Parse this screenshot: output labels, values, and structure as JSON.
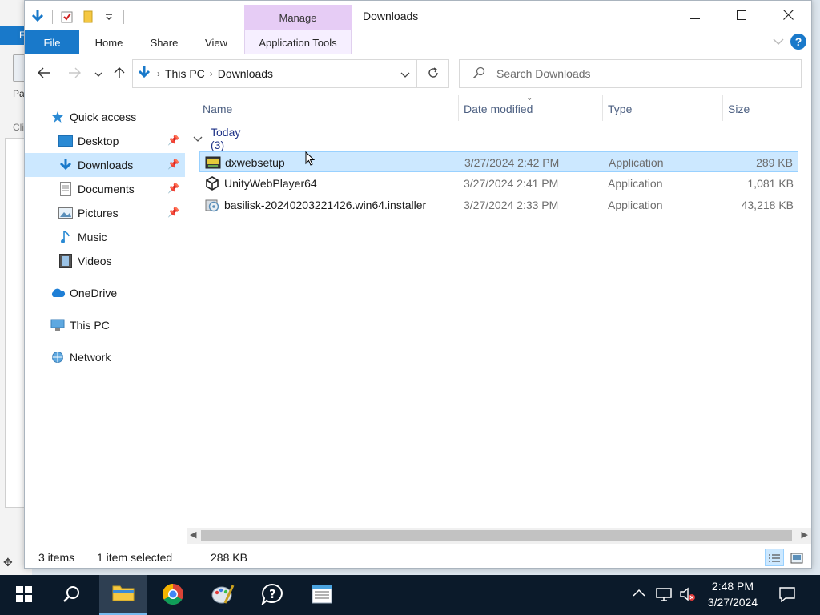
{
  "window": {
    "title": "Downloads",
    "contextual_tab": "Manage",
    "controls": {
      "minimize": "minimize-icon",
      "maximize": "maximize-icon",
      "close": "close-icon"
    }
  },
  "ribbon": {
    "tabs": [
      "File",
      "Home",
      "Share",
      "View",
      "Application Tools"
    ]
  },
  "address": {
    "crumbs": [
      "This PC",
      "Downloads"
    ]
  },
  "search": {
    "placeholder": "Search Downloads"
  },
  "nav": {
    "quick_access": "Quick access",
    "items": [
      {
        "label": "Desktop",
        "pinned": true
      },
      {
        "label": "Downloads",
        "pinned": true,
        "selected": true
      },
      {
        "label": "Documents",
        "pinned": true
      },
      {
        "label": "Pictures",
        "pinned": true
      },
      {
        "label": "Music",
        "pinned": false
      },
      {
        "label": "Videos",
        "pinned": false
      }
    ],
    "onedrive": "OneDrive",
    "thispc": "This PC",
    "network": "Network"
  },
  "columns": {
    "name": "Name",
    "date": "Date modified",
    "type": "Type",
    "size": "Size"
  },
  "group": {
    "label": "Today (3)"
  },
  "files": [
    {
      "name": "dxwebsetup",
      "date": "3/27/2024 2:42 PM",
      "type": "Application",
      "size": "289 KB",
      "selected": true
    },
    {
      "name": "UnityWebPlayer64",
      "date": "3/27/2024 2:41 PM",
      "type": "Application",
      "size": "1,081 KB",
      "selected": false
    },
    {
      "name": "basilisk-20240203221426.win64.installer",
      "date": "3/27/2024 2:33 PM",
      "type": "Application",
      "size": "43,218 KB",
      "selected": false
    }
  ],
  "status": {
    "count": "3 items",
    "selection": "1 item selected",
    "size": "288 KB"
  },
  "taskbar": {
    "time": "2:48 PM",
    "date": "3/27/2024"
  },
  "colors": {
    "accent": "#1979ca",
    "selection": "#cce8ff",
    "manage": "#e6ccf5",
    "taskbar": "#0b1a2a"
  }
}
